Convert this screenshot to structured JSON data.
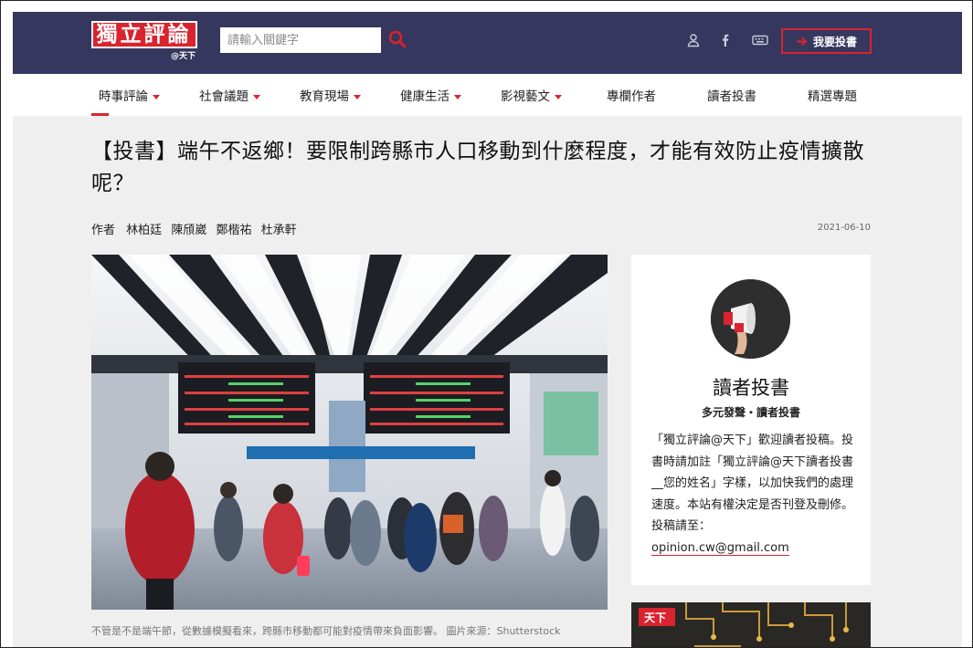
{
  "header": {
    "logo_chars": [
      "獨",
      "立",
      "評",
      "論"
    ],
    "logo_sub": "@天下",
    "search_placeholder": "請輸入關鍵字",
    "submit_label": "我要投書"
  },
  "nav": {
    "items": [
      {
        "label": "時事評論",
        "caret": true
      },
      {
        "label": "社會議題",
        "caret": true
      },
      {
        "label": "教育現場",
        "caret": true
      },
      {
        "label": "健康生活",
        "caret": true
      },
      {
        "label": "影視藝文",
        "caret": true
      },
      {
        "label": "專欄作者",
        "caret": false
      },
      {
        "label": "讀者投書",
        "caret": false
      },
      {
        "label": "精選專題",
        "caret": false
      }
    ]
  },
  "article": {
    "title": "【投書】端午不返鄉！要限制跨縣市人口移動到什麼程度，才能有效防止疫情擴散呢？",
    "author_label": "作者",
    "authors": [
      "林柏廷",
      "陳頎崴",
      "鄭楷祐",
      "杜承軒"
    ],
    "date": "2021-06-10",
    "caption": "不管是不是端午節，從數據模擬看來，跨縣市移動都可能對疫情帶來負面影響。 圖片來源：Shutterstock"
  },
  "sidebar": {
    "title": "讀者投書",
    "subtitle": "多元發聲・讀者投書",
    "body": "「獨立評論@天下」歡迎讀者投稿。投書時請加註「獨立評論@天下讀者投書__您的姓名」字樣，以加快我們的處理速度。本站有權決定是否刊登及刪修。投稿請至：",
    "email": "opinion.cw@gmail.com"
  },
  "ad": {
    "logo_text": "天下"
  },
  "colors": {
    "brand_red": "#d9232e",
    "header_navy": "#36375e",
    "page_bg": "#efefef"
  }
}
